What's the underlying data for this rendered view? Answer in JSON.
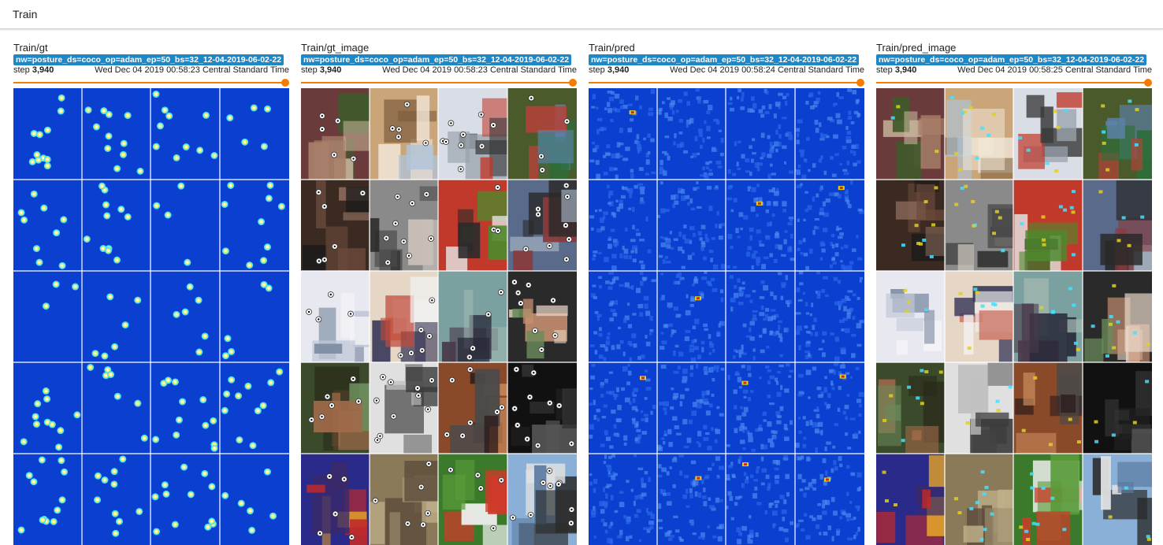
{
  "header": {
    "title": "Train"
  },
  "run_label": "nw=posture_ds=coco_op=adam_ep=50_bs=32_12-04-2019-06-02-22",
  "step_word": "step",
  "cards": [
    {
      "id": "gt",
      "title": "Train/gt",
      "step": "3,940",
      "timestamp": "Wed Dec 04 2019 00:58:23 Central Standard Time",
      "kind": "heatmap"
    },
    {
      "id": "gt_image",
      "title": "Train/gt_image",
      "step": "3,940",
      "timestamp": "Wed Dec 04 2019 00:58:23 Central Standard Time",
      "kind": "photo-keypoints"
    },
    {
      "id": "pred",
      "title": "Train/pred",
      "step": "3,940",
      "timestamp": "Wed Dec 04 2019 00:58:24 Central Standard Time",
      "kind": "noisy-heatmap"
    },
    {
      "id": "pred_image",
      "title": "Train/pred_image",
      "step": "3,940",
      "timestamp": "Wed Dec 04 2019 00:58:25 Central Standard Time",
      "kind": "photo-overlay"
    }
  ],
  "colors": {
    "accent": "#f57c00",
    "badge": "#1e88c7",
    "heatmap_bg": "#0a3fd0"
  }
}
